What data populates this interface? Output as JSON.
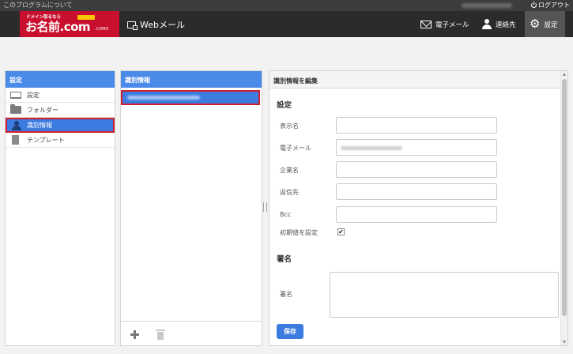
{
  "topbar": {
    "about": "このプログラムについて",
    "logout": "ログアウト"
  },
  "header": {
    "logo_tagline": "ドメイン取るなら",
    "logo_main": "お名前.com",
    "logo_sub": ".COMO",
    "app_title": "Webメール",
    "nav": {
      "mail": "電子メール",
      "contacts": "連絡先",
      "settings": "設定"
    }
  },
  "sidebar": {
    "header": "設定",
    "items": [
      {
        "label": "設定",
        "icon": "laptop-icon"
      },
      {
        "label": "フォルダー",
        "icon": "folder-icon"
      },
      {
        "label": "識別情報",
        "icon": "person-icon",
        "active": true
      },
      {
        "label": "テンプレート",
        "icon": "document-icon"
      }
    ]
  },
  "identities": {
    "header": "識別情報"
  },
  "editor": {
    "header": "識別情報を編集",
    "settings_section": "設定",
    "fields": {
      "display_name": {
        "label": "表示名",
        "value": ""
      },
      "email": {
        "label": "電子メール"
      },
      "organization": {
        "label": "企業名",
        "value": ""
      },
      "reply_to": {
        "label": "返信先",
        "value": ""
      },
      "bcc": {
        "label": "Bcc",
        "value": ""
      },
      "default": {
        "label": "初期値を設定",
        "checked": "✔"
      }
    },
    "signature_section": "署名",
    "signature_label": "署名",
    "save_label": "保存"
  },
  "colors": {
    "accent": "#3c7be0",
    "panel_header": "#4a8ae8",
    "highlight_border": "#d11e2e",
    "topbar": "#3c3c3c",
    "header": "#2b2b2b",
    "logo_red": "#c8102e"
  }
}
